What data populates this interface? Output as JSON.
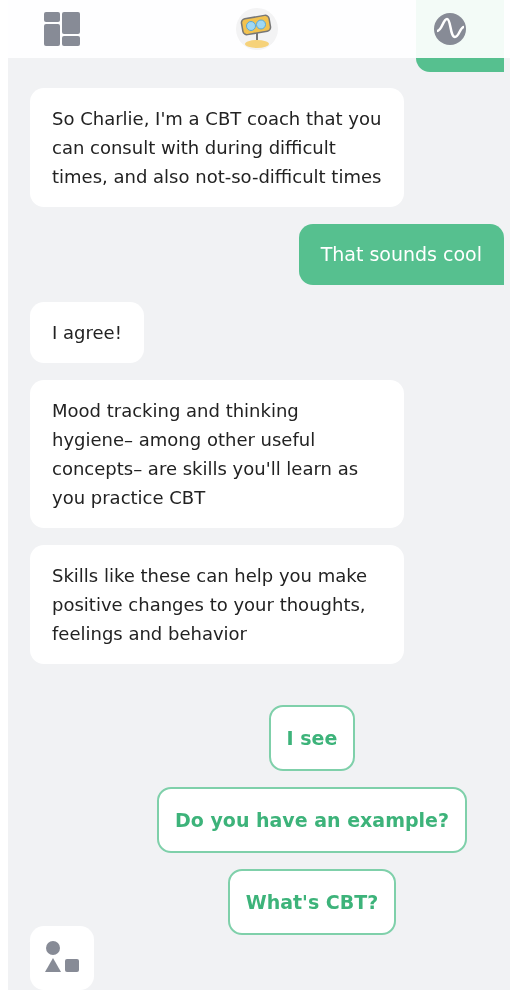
{
  "messages": [
    {
      "kind": "bot",
      "text": "So Charlie, I'm a CBT coach that you can consult with during difficult times, and also not-so-difficult times"
    },
    {
      "kind": "user",
      "text": "That sounds cool"
    },
    {
      "kind": "bot",
      "text": "I agree!"
    },
    {
      "kind": "bot",
      "text": "Mood tracking and thinking hygiene– among other useful concepts– are skills you'll learn as you practice CBT"
    },
    {
      "kind": "bot",
      "text": "Skills like these can help you make positive changes to your thoughts, feelings and behavior"
    }
  ],
  "quick_replies": [
    "I see",
    "Do you have an example?",
    "What's CBT?"
  ]
}
